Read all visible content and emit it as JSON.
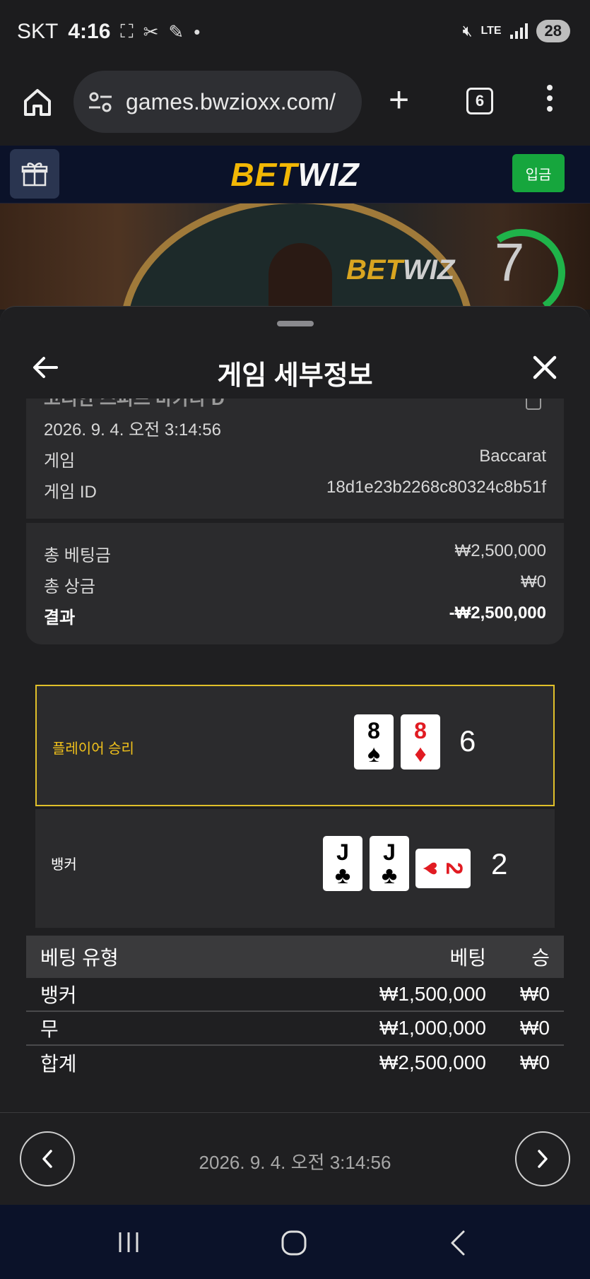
{
  "status_bar": {
    "carrier": "SKT",
    "time": "4:16",
    "network": "LTE",
    "battery": "28"
  },
  "browser": {
    "url": "games.bwzioxx.com/",
    "tab_count": "6"
  },
  "site": {
    "logo_bet": "BET",
    "logo_wiz": "WIZ",
    "deposit_label": "입금"
  },
  "video": {
    "logo_bet": "BET",
    "logo_wiz": "WIZ",
    "timer": "7"
  },
  "sheet": {
    "title": "게임 세부정보",
    "game_title_cut": "코리안 스피드 바카라 D",
    "datetime": "2026. 9. 4. 오전 3:14:56",
    "info": [
      {
        "label": "게임",
        "value": "Baccarat"
      },
      {
        "label": "게임 ID",
        "value": "18d1e23b2268c80324c8b51f"
      }
    ],
    "totals": [
      {
        "label": "총 베팅금",
        "value": "₩2,500,000"
      },
      {
        "label": "총 상금",
        "value": "₩0"
      },
      {
        "label": "결과",
        "value": "-₩2,500,000"
      }
    ],
    "player": {
      "label": "플레이어 승리",
      "label_color": "#f2c21b",
      "cards": [
        {
          "rank": "8",
          "suit": "♠"
        },
        {
          "rank": "8",
          "suit": "♦"
        }
      ],
      "score": "6"
    },
    "banker": {
      "label": "뱅커",
      "cards": [
        {
          "rank": "J",
          "suit": "♣"
        },
        {
          "rank": "J",
          "suit": "♣"
        },
        {
          "rank": "2",
          "suit": "♥"
        }
      ],
      "score": "2"
    },
    "bet_table": {
      "headers": [
        "베팅 유형",
        "베팅",
        "승"
      ],
      "rows": [
        [
          "뱅커",
          "₩1,500,000",
          "₩0"
        ],
        [
          "무",
          "₩1,000,000",
          "₩0"
        ],
        [
          "합계",
          "₩2,500,000",
          "₩0"
        ]
      ]
    },
    "footer_date": "2026. 9. 4. 오전 3:14:56"
  },
  "colors": {
    "accent_gold": "#f2b705",
    "deposit_green": "#16a63d",
    "highlight_border": "#e0c02a"
  }
}
